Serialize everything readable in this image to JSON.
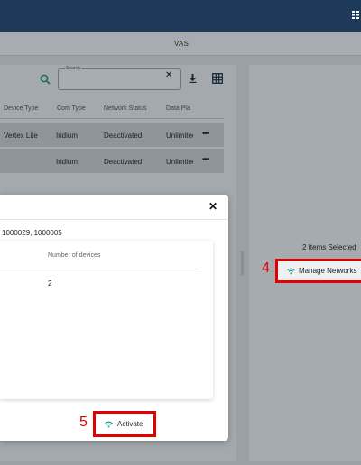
{
  "header": {
    "tab_title": "VAS"
  },
  "toolbar": {
    "search_label": "Search",
    "search_value": ""
  },
  "table": {
    "columns": [
      "Device Type",
      "Com Type",
      "Network Status",
      "Data Pla"
    ],
    "rows": [
      {
        "device_type": "Vertex Lite",
        "com_type": "Iridium",
        "network_status": "Deactivated",
        "data_plan": "Unlimited"
      },
      {
        "device_type": "",
        "com_type": "Iridium",
        "network_status": "Deactivated",
        "data_plan": "Unlimited"
      }
    ]
  },
  "right_panel": {
    "selected_text": "2 Items Selected",
    "step_number": "4",
    "manage_label": "Manage Networks"
  },
  "modal": {
    "device_ids": "1000029, 1000005",
    "column_header": "Number of devices",
    "device_count": "2",
    "step_number": "5",
    "activate_label": "Activate"
  },
  "colors": {
    "accent": "#2a9d8f",
    "highlight": "#e30000",
    "header": "#1d3a5b"
  }
}
